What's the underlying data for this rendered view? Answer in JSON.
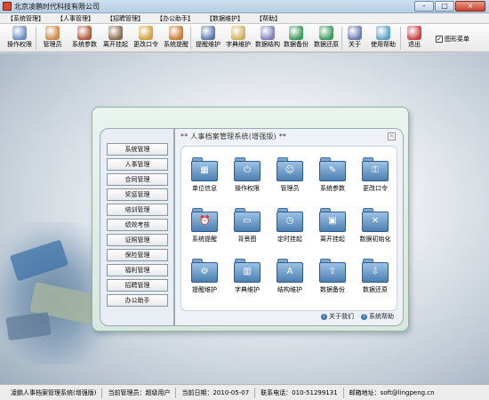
{
  "window": {
    "title": "北京凌鹏时代科技有限公司",
    "controls": [
      "–",
      "□",
      "×"
    ]
  },
  "menu": [
    "【系统管理】",
    "【人事管理】",
    "【招聘管理】",
    "【办公助手】",
    "【数据维护】",
    "【帮助】"
  ],
  "toolbar": {
    "buttons": [
      {
        "label": "操作权限",
        "icon": "key-icon",
        "color": "#6a8cc0"
      },
      {
        "label": "管理员",
        "icon": "admin-user-icon",
        "color": "#c8894a"
      },
      {
        "label": "系统参数",
        "icon": "settings-tools-icon",
        "color": "#b05a3a"
      },
      {
        "label": "离开挂起",
        "icon": "people-leave-icon",
        "color": "#8a6a4a"
      },
      {
        "label": "更改口令",
        "icon": "password-icon",
        "color": "#d0a040"
      },
      {
        "label": "系统提醒",
        "icon": "reminder-people-icon",
        "color": "#c87a30"
      },
      {
        "label": "提醒维护",
        "icon": "reminder-edit-icon",
        "color": "#5a7aa8"
      },
      {
        "label": "字典维护",
        "icon": "dictionary-icon",
        "color": "#d0b060"
      },
      {
        "label": "数据结构",
        "icon": "data-structure-icon",
        "color": "#8080c0"
      },
      {
        "label": "数据备份",
        "icon": "backup-recycle-icon",
        "color": "#3a9a5a"
      },
      {
        "label": "数据还原",
        "icon": "restore-recycle-icon",
        "color": "#3a9a5a"
      },
      {
        "label": "关于",
        "icon": "about-icon",
        "color": "#6a7ab0"
      },
      {
        "label": "使用帮助",
        "icon": "help-icon",
        "color": "#5aa0c8"
      },
      {
        "label": "退出",
        "icon": "exit-door-icon",
        "color": "#c84040"
      }
    ],
    "checkbox_label": "图形菜单",
    "checkbox_checked": true
  },
  "panel": {
    "heading": "** 人事档案管理系统(增强版) **",
    "nav": [
      "系统管理",
      "人事管理",
      "合同管理",
      "奖惩管理",
      "培训管理",
      "绩效考核",
      "证照管理",
      "保险管理",
      "福利管理",
      "招聘管理",
      "办公助手"
    ],
    "grid": [
      {
        "label": "单位信息",
        "icon": "company-info-icon",
        "glyph": "▦"
      },
      {
        "label": "操作权限",
        "icon": "power-icon",
        "glyph": "⏻"
      },
      {
        "label": "管理员",
        "icon": "admin-icon",
        "glyph": "☺"
      },
      {
        "label": "系统参数",
        "icon": "parameters-icon",
        "glyph": "✎"
      },
      {
        "label": "更改口令",
        "icon": "password-key-icon",
        "glyph": "⚿"
      },
      {
        "label": "系统提醒",
        "icon": "alarm-clock-icon",
        "glyph": "⏰"
      },
      {
        "label": "背景图",
        "icon": "background-image-icon",
        "glyph": "▭"
      },
      {
        "label": "定时挂起",
        "icon": "timer-clock-icon",
        "glyph": "◷"
      },
      {
        "label": "离开挂起",
        "icon": "lock-icon",
        "glyph": "▣"
      },
      {
        "label": "数据初始化",
        "icon": "data-init-icon",
        "glyph": "✕"
      },
      {
        "label": "提醒维护",
        "icon": "gear-icon",
        "glyph": "⚙"
      },
      {
        "label": "字典维护",
        "icon": "books-icon",
        "glyph": "▥"
      },
      {
        "label": "结构维护",
        "icon": "font-structure-icon",
        "glyph": "A"
      },
      {
        "label": "数据备份",
        "icon": "arrow-up-icon",
        "glyph": "⇧"
      },
      {
        "label": "数据还原",
        "icon": "arrow-down-icon",
        "glyph": "⇩"
      }
    ],
    "about_label": "关于我们",
    "help_label": "系统帮助"
  },
  "status": [
    "凌鹏人事档案管理系统(增强版)",
    "当前管理员：超级用户",
    "当前日期：2010-05-07",
    "联系电话：010-51299131",
    "邮箱地址：soft@lingpeng.cn"
  ]
}
